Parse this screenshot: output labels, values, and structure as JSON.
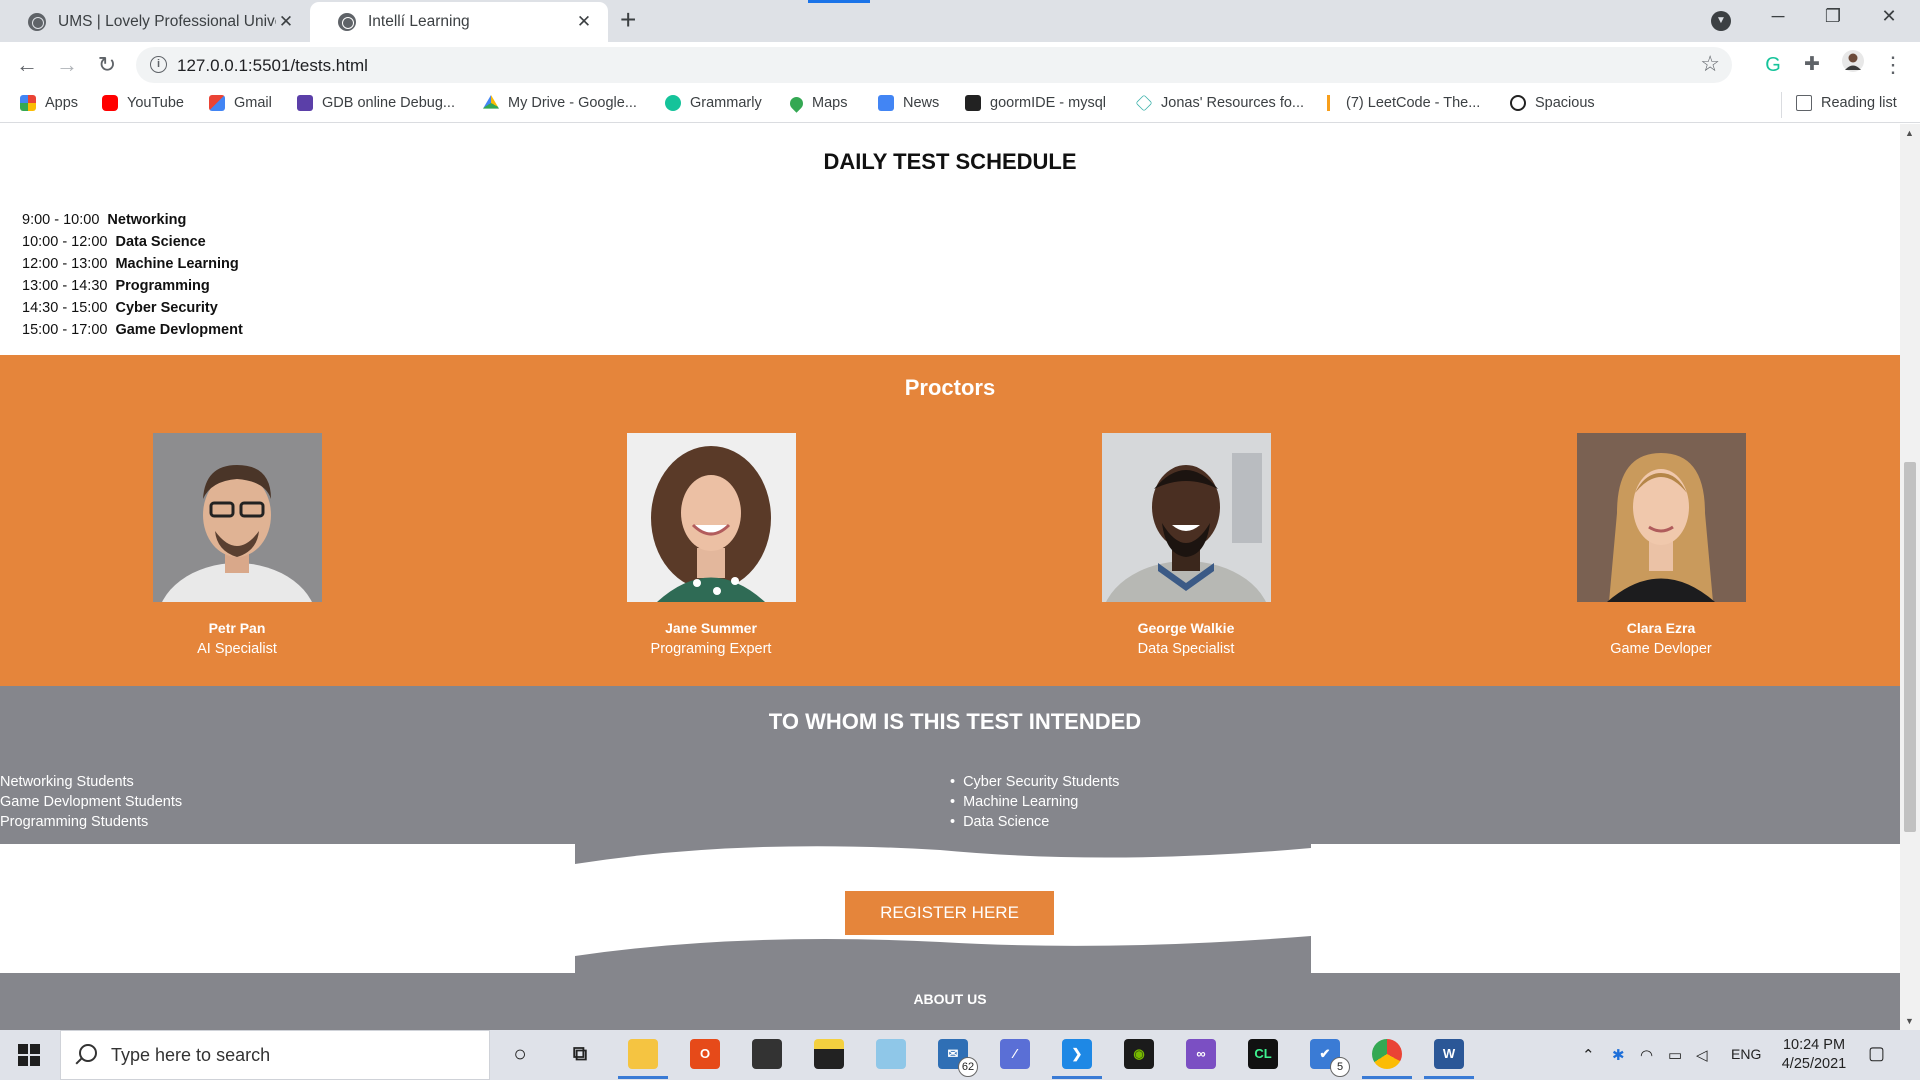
{
  "browser": {
    "tabs": [
      {
        "title": "UMS | Lovely Professional Univer",
        "close": "✕",
        "active": false
      },
      {
        "title": "Intellí Learning",
        "close": "✕",
        "active": true
      }
    ],
    "new_tab": "+",
    "window_controls": {
      "minimize": "─",
      "maximize": "❐",
      "close": "✕"
    },
    "url": "127.0.0.1:5501/tests.html",
    "bookmarks": [
      {
        "label": "Apps",
        "icon": "apps-grid-icon",
        "color": "#ea4335"
      },
      {
        "label": "YouTube",
        "icon": "youtube-icon",
        "color": "#ff0000"
      },
      {
        "label": "Gmail",
        "icon": "gmail-icon",
        "color": "#ea4335"
      },
      {
        "label": "GDB online Debug...",
        "icon": "gdb-icon",
        "color": "#5b3fa8"
      },
      {
        "label": "My Drive - Google...",
        "icon": "google-drive-icon",
        "color": "#fbbc04"
      },
      {
        "label": "Grammarly",
        "icon": "grammarly-icon",
        "color": "#15c39a"
      },
      {
        "label": "Maps",
        "icon": "maps-pin-icon",
        "color": "#34a853"
      },
      {
        "label": "News",
        "icon": "google-news-icon",
        "color": "#4285f4"
      },
      {
        "label": "goormIDE - mysql",
        "icon": "goorm-icon",
        "color": "#222222"
      },
      {
        "label": "Jonas' Resources fo...",
        "icon": "diamond-icon",
        "color": "#39b0a9"
      },
      {
        "label": "(7) LeetCode - The...",
        "icon": "leetcode-icon",
        "color": "#f89f1b"
      },
      {
        "label": "Spacious",
        "icon": "spacious-icon",
        "color": "#222222"
      }
    ],
    "reading_list": "Reading list"
  },
  "page": {
    "schedule_title": "DAILY TEST SCHEDULE",
    "schedule": [
      {
        "time": "9:00 - 10:00",
        "subject": "Networking"
      },
      {
        "time": "10:00 - 12:00",
        "subject": "Data Science"
      },
      {
        "time": "12:00 - 13:00",
        "subject": "Machine Learning"
      },
      {
        "time": "13:00 - 14:30",
        "subject": "Programming"
      },
      {
        "time": "14:30 - 15:00",
        "subject": "Cyber Security"
      },
      {
        "time": "15:00 - 17:00",
        "subject": "Game Devlopment"
      }
    ],
    "proctors_title": "Proctors",
    "proctors": [
      {
        "name": "Petr Pan",
        "role": "AI Specialist"
      },
      {
        "name": "Jane Summer",
        "role": "Programing Expert"
      },
      {
        "name": "George Walkie",
        "role": "Data  Specialist"
      },
      {
        "name": "Clara Ezra",
        "role": "Game Devloper"
      }
    ],
    "audience_title": "TO WHOM IS THIS TEST INTENDED",
    "audience_left": [
      "Networking Students",
      "Game Devlopment Students",
      "Programming Students"
    ],
    "audience_right": [
      "Cyber Security Students",
      "Machine Learning",
      "Data Science"
    ],
    "register_label": "REGISTER HERE",
    "about_title": "ABOUT US"
  },
  "taskbar": {
    "search_placeholder": "Type here to search",
    "mail_badge": "62",
    "todo_badge": "5",
    "language": "ENG",
    "time": "10:24 PM",
    "date": "4/25/2021"
  },
  "colors": {
    "accent_orange": "#e5853b",
    "band_gray": "#85868c",
    "chrome_tab_bg": "#dee1e6"
  }
}
